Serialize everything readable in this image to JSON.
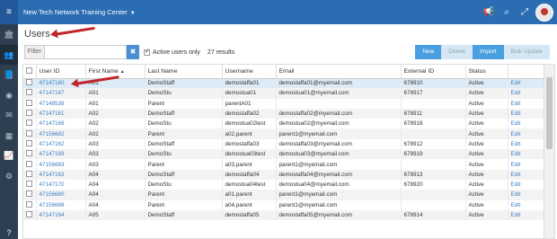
{
  "app": {
    "title": "New Tech Network Training Center"
  },
  "page": {
    "title": "Users"
  },
  "filter": {
    "label": "Filter",
    "placeholder": "",
    "value": ""
  },
  "active_only": {
    "label": "Active users only",
    "checked": true
  },
  "results": "27 results",
  "actions": {
    "new": "New",
    "delete": "Delete",
    "import": "Import",
    "bulk_update": "Bulk Update"
  },
  "columns": [
    "User ID",
    "First Name",
    "Last Name",
    "Username",
    "Email",
    "External ID",
    "Status",
    ""
  ],
  "sort_indicator": "▲",
  "rows": [
    {
      "id": "47147160",
      "first": "A01",
      "last": "DemoStaff",
      "user": "demostaffa01",
      "email": "demostaffa01@myemail.com",
      "ext": "678910",
      "status": "Active",
      "action": "Edit"
    },
    {
      "id": "47147167",
      "first": "A01",
      "last": "DemoStu",
      "user": "demostua01",
      "email": "demostua01@myemail.com",
      "ext": "678917",
      "status": "Active",
      "action": "Edit"
    },
    {
      "id": "47148538",
      "first": "A01",
      "last": "Parent",
      "user": "parentA01",
      "email": "",
      "ext": "",
      "status": "Active",
      "action": "Edit"
    },
    {
      "id": "47147161",
      "first": "A02",
      "last": "DemoStaff",
      "user": "demostaffa02",
      "email": "demostaffa02@myemail.com",
      "ext": "678911",
      "status": "Active",
      "action": "Edit"
    },
    {
      "id": "47147168",
      "first": "A02",
      "last": "DemoStu",
      "user": "demostua02test",
      "email": "demostua02@myemail.com",
      "ext": "678918",
      "status": "Active",
      "action": "Edit"
    },
    {
      "id": "47156682",
      "first": "A02",
      "last": "Parent",
      "user": "a02.parent",
      "email": "parent1@myemail.com",
      "ext": "",
      "status": "Active",
      "action": "Edit"
    },
    {
      "id": "47147162",
      "first": "A03",
      "last": "DemoStaff",
      "user": "demostaffa03",
      "email": "demostaffa03@myemail.com",
      "ext": "678912",
      "status": "Active",
      "action": "Edit"
    },
    {
      "id": "47147169",
      "first": "A03",
      "last": "DemoStu",
      "user": "demostua03test",
      "email": "demostua03@myemail.com",
      "ext": "678919",
      "status": "Active",
      "action": "Edit"
    },
    {
      "id": "47156683",
      "first": "A03",
      "last": "Parent",
      "user": "a03.parent",
      "email": "parent1@myemail.com",
      "ext": "",
      "status": "Active",
      "action": "Edit"
    },
    {
      "id": "47147163",
      "first": "A04",
      "last": "DemoStaff",
      "user": "demostaffa04",
      "email": "demostaffa04@myemail.com",
      "ext": "678913",
      "status": "Active",
      "action": "Edit"
    },
    {
      "id": "47147170",
      "first": "A04",
      "last": "DemoStu",
      "user": "demostua04test",
      "email": "demostua04@myemail.com",
      "ext": "678920",
      "status": "Active",
      "action": "Edit"
    },
    {
      "id": "47156680",
      "first": "A04",
      "last": "Parent",
      "user": "a01.parent",
      "email": "parent1@myemail.com",
      "ext": "",
      "status": "Active",
      "action": "Edit"
    },
    {
      "id": "47156688",
      "first": "A04",
      "last": "Parent",
      "user": "a04.parent",
      "email": "parent1@myemail.com",
      "ext": "",
      "status": "Active",
      "action": "Edit"
    },
    {
      "id": "47147164",
      "first": "A05",
      "last": "DemoStaff",
      "user": "demostaffa05",
      "email": "demostaffa05@myemail.com",
      "ext": "678914",
      "status": "Active",
      "action": "Edit"
    }
  ],
  "colors": {
    "topbar": "#2a6db3",
    "sidebar": "#2f3f52",
    "accent": "#4a9fe0",
    "link": "#3b7fc4",
    "annotation_arrow": "#c0252b"
  },
  "icons": {
    "topbar": [
      "megaphone-icon",
      "search-icon",
      "expand-icon"
    ],
    "sidebar": [
      "bank-icon",
      "users-icon",
      "book-icon",
      "target-icon",
      "mail-icon",
      "table-icon",
      "chart-icon",
      "gear-icon"
    ]
  }
}
